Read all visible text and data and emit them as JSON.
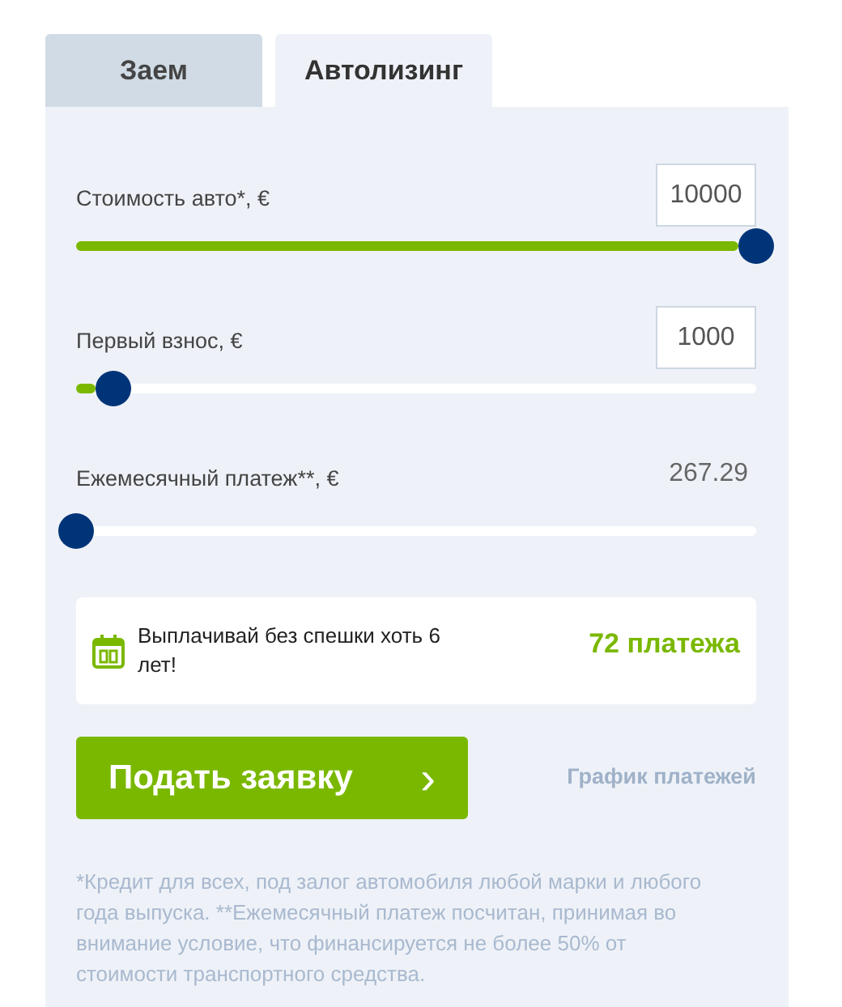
{
  "tabs": [
    {
      "label": "Заем",
      "selected": false
    },
    {
      "label": "Автолизинг",
      "selected": true
    }
  ],
  "sliders": [
    {
      "kind": "input",
      "label": "Стоимость авто*, €",
      "value": "10000",
      "level": 1
    },
    {
      "kind": "input",
      "label": "Первый взнос, €",
      "value": "1000",
      "level": 0.055
    },
    {
      "kind": "reading",
      "label": "Ежемесячный платеж**, €",
      "reading": "267.29",
      "level": 0
    }
  ],
  "info": {
    "text": "Выплачивай без спешки хоть 6 лет!",
    "payments": "72 платежа"
  },
  "apply_button": {
    "label": "Подать заявку",
    "arrow": "›"
  },
  "schedule_link": "График платежей",
  "footnote": "*Кредит для всех, под залог автомобиля любой марки и любого года выпуска. **Ежемесячный платеж посчитан, принимая во внимание условие, что финансируется не более 50% от стоимости транспортного средства."
}
